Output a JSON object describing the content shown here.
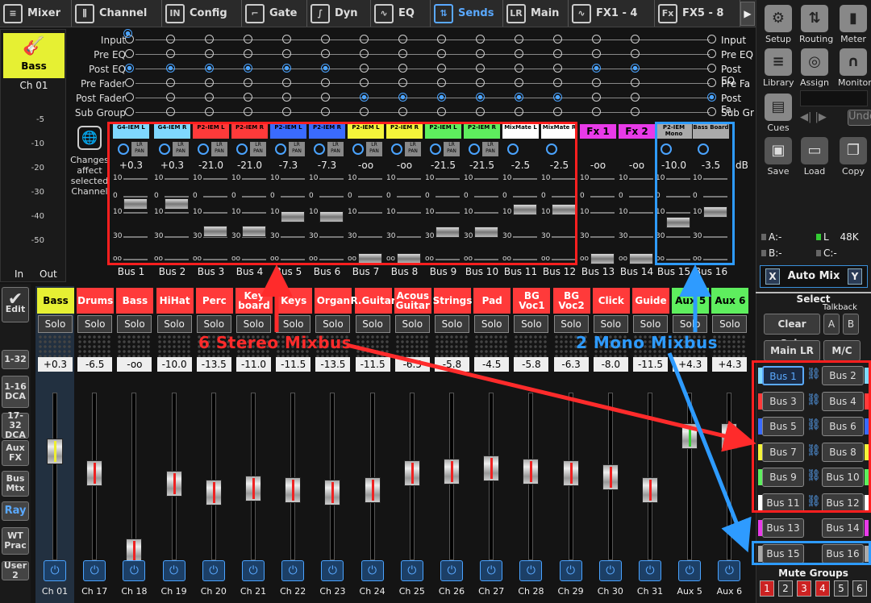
{
  "tabs": [
    {
      "label": "Mixer",
      "icon": "mixer-icon"
    },
    {
      "label": "Channel",
      "icon": "channel-icon"
    },
    {
      "label": "Config",
      "icon": "config-icon"
    },
    {
      "label": "Gate",
      "icon": "gate-icon"
    },
    {
      "label": "Dyn",
      "icon": "dynamics-icon"
    },
    {
      "label": "EQ",
      "icon": "eq-icon"
    },
    {
      "label": "Sends",
      "icon": "sends-icon",
      "active": true
    },
    {
      "label": "Main",
      "icon": "main-icon"
    },
    {
      "label": "FX1 - 4",
      "icon": "fx-wave-icon"
    },
    {
      "label": "FX5 - 8",
      "icon": "fx-icon"
    }
  ],
  "selected_channel": {
    "name": "Bass",
    "number": "Ch 01",
    "in_label": "In",
    "out_label": "Out",
    "scale": [
      "-5",
      "-10",
      "-20",
      "-30",
      "-40",
      "-50"
    ]
  },
  "tap_points": [
    "Input",
    "Pre EQ",
    "Post EQ",
    "Pre Fader",
    "Post Fader",
    "Sub Group"
  ],
  "tap_points_right": [
    "Input",
    "Pre EQ",
    "Post EQ",
    "Pre Fa",
    "Post Fa",
    "Sub Gr"
  ],
  "changes_note": [
    "Changes",
    "affect",
    "selected",
    "Channel"
  ],
  "sends": [
    {
      "label": "G4-IEM L",
      "value": "+0.3",
      "bus": "Bus 1",
      "color": "#7fd8ff",
      "lrpan": true,
      "level": 0.7
    },
    {
      "label": "G4-IEM R",
      "value": "+0.3",
      "bus": "Bus 2",
      "color": "#7fd8ff",
      "lrpan": true,
      "level": 0.7
    },
    {
      "label": "P2-IEM L",
      "value": "-21.0",
      "bus": "Bus 3",
      "color": "#ff3a3a",
      "lrpan": true,
      "level": 0.36
    },
    {
      "label": "P2-IEM R",
      "value": "-21.0",
      "bus": "Bus 4",
      "color": "#ff3a3a",
      "lrpan": true,
      "level": 0.36
    },
    {
      "label": "P2-IEM L",
      "value": "-7.3",
      "bus": "Bus 5",
      "color": "#3a6bff",
      "lrpan": true,
      "level": 0.54
    },
    {
      "label": "P2-IEM R",
      "value": "-7.3",
      "bus": "Bus 6",
      "color": "#3a6bff",
      "lrpan": true,
      "level": 0.54
    },
    {
      "label": "P2-IEM L",
      "value": "-oo",
      "bus": "Bus 7",
      "color": "#f4f43a",
      "lrpan": true,
      "level": 0.02
    },
    {
      "label": "P2-IEM R",
      "value": "-oo",
      "bus": "Bus 8",
      "color": "#f4f43a",
      "lrpan": true,
      "level": 0.02
    },
    {
      "label": "P2-IEM L",
      "value": "-21.5",
      "bus": "Bus 9",
      "color": "#5eee5e",
      "lrpan": true,
      "level": 0.35
    },
    {
      "label": "P2-IEM R",
      "value": "-21.5",
      "bus": "Bus 10",
      "color": "#5eee5e",
      "lrpan": true,
      "level": 0.35
    },
    {
      "label": "MixMate L",
      "value": "-2.5",
      "bus": "Bus 11",
      "color": "#ffffff",
      "lrpan": false,
      "level": 0.63
    },
    {
      "label": "MixMate R",
      "value": "-2.5",
      "bus": "Bus 12",
      "color": "#ffffff",
      "lrpan": false,
      "level": 0.63
    },
    {
      "label": "Fx 1",
      "value": "-oo",
      "bus": "Bus 13",
      "color": "#e83ae8",
      "lrpan": false,
      "level": 0.02
    },
    {
      "label": "Fx 2",
      "value": "-oo",
      "bus": "Bus 14",
      "color": "#e83ae8",
      "lrpan": false,
      "level": 0.02
    },
    {
      "label": "P2-IEM Mono",
      "value": "-10.0",
      "bus": "Bus 15",
      "color": "#aaaaaa",
      "lrpan": false,
      "level": 0.47
    },
    {
      "label": "Bass Board",
      "value": "-3.5",
      "bus": "Bus 16",
      "color": "#aaaaaa",
      "lrpan": false,
      "level": 0.6
    }
  ],
  "send_scale": [
    "10",
    "0",
    "10",
    "30",
    "oo"
  ],
  "db_unit": "dB",
  "right_panel": {
    "top_buttons": [
      {
        "label": "Setup",
        "icon": "gear-icon"
      },
      {
        "label": "Routing",
        "icon": "routing-icon"
      },
      {
        "label": "Meter",
        "icon": "meter-icon"
      },
      {
        "label": "Library",
        "icon": "library-icon"
      },
      {
        "label": "Assign",
        "icon": "assign-icon"
      },
      {
        "label": "Monitor",
        "icon": "headphones-icon"
      },
      {
        "label": "Cues",
        "icon": "cues-icon"
      },
      {
        "label": "Save",
        "icon": "save-icon"
      },
      {
        "label": "Load",
        "icon": "load-icon"
      },
      {
        "label": "Copy",
        "icon": "copy-icon"
      }
    ],
    "undo_label": "Undo",
    "status": {
      "a": "A:-",
      "l": "L",
      "rate": "48K",
      "b": "B:-",
      "c": "C:-"
    },
    "automix": {
      "label": "Auto Mix",
      "x": "X",
      "y": "Y"
    },
    "select_title": "Select",
    "talkback_label": "Talkback",
    "clear_solo": "Clear Solo",
    "talkback_a": "A",
    "talkback_b": "B",
    "main_lr": "Main LR",
    "mc": "M/C",
    "bus_buttons": [
      "Bus 1",
      "Bus 2",
      "Bus 3",
      "Bus 4",
      "Bus 5",
      "Bus 6",
      "Bus 7",
      "Bus 8",
      "Bus 9",
      "Bus 10",
      "Bus 11",
      "Bus 12",
      "Bus 13",
      "Bus 14",
      "Bus 15",
      "Bus 16"
    ],
    "bus_colors": [
      "#7fd8ff",
      "#ff3a3a",
      "#3a6bff",
      "#f4f43a",
      "#5eee5e",
      "#ffffff",
      "#e83ae8",
      "#aaaaaa"
    ],
    "mute_groups_title": "Mute Groups",
    "mute_groups": [
      "1",
      "2",
      "3",
      "4",
      "5",
      "6"
    ],
    "mute_on": [
      true,
      false,
      true,
      true,
      false,
      false
    ]
  },
  "left_nav": [
    {
      "label": "Edit",
      "icon": "checkmark-icon"
    },
    {
      "label": "1-32"
    },
    {
      "label": "1-16 DCA"
    },
    {
      "label": "17-32 DCA"
    },
    {
      "label": "Aux FX"
    },
    {
      "label": "Bus Mtx"
    },
    {
      "label": "Ray",
      "active": true
    },
    {
      "label": "WT Prac"
    },
    {
      "label": "User 2"
    }
  ],
  "strips": [
    {
      "name": "Bass",
      "color": "#e6f033",
      "value": "+0.3",
      "num": "Ch 01",
      "level": 0.7,
      "cap": "yel"
    },
    {
      "name": "Drums",
      "color": "#ff3a3a",
      "value": "-6.5",
      "num": "Ch 17",
      "level": 0.56
    },
    {
      "name": "Bass",
      "color": "#ff3a3a",
      "value": "-oo",
      "num": "Ch 18",
      "level": 0.05
    },
    {
      "name": "HiHat",
      "color": "#ff3a3a",
      "value": "-10.0",
      "num": "Ch 19",
      "level": 0.49
    },
    {
      "name": "Perc",
      "color": "#ff3a3a",
      "value": "-13.5",
      "num": "Ch 20",
      "level": 0.43
    },
    {
      "name": "Key board",
      "color": "#ff3a3a",
      "value": "-11.0",
      "num": "Ch 21",
      "level": 0.46
    },
    {
      "name": "Keys",
      "color": "#ff3a3a",
      "value": "-11.5",
      "num": "Ch 22",
      "level": 0.45
    },
    {
      "name": "Organ",
      "color": "#ff3a3a",
      "value": "-13.5",
      "num": "Ch 23",
      "level": 0.43
    },
    {
      "name": "R.Guitar",
      "color": "#ff3a3a",
      "value": "-11.5",
      "num": "Ch 24",
      "level": 0.45
    },
    {
      "name": "Acous Guitar",
      "color": "#ff3a3a",
      "value": "-6.5",
      "num": "Ch 25",
      "level": 0.56
    },
    {
      "name": "Strings",
      "color": "#ff3a3a",
      "value": "-5.8",
      "num": "Ch 26",
      "level": 0.57
    },
    {
      "name": "Pad",
      "color": "#ff3a3a",
      "value": "-4.5",
      "num": "Ch 27",
      "level": 0.59
    },
    {
      "name": "BG Voc1",
      "color": "#ff3a3a",
      "value": "-5.8",
      "num": "Ch 28",
      "level": 0.57
    },
    {
      "name": "BG Voc2",
      "color": "#ff3a3a",
      "value": "-6.3",
      "num": "Ch 29",
      "level": 0.56
    },
    {
      "name": "Click",
      "color": "#ff3a3a",
      "value": "-8.0",
      "num": "Ch 30",
      "level": 0.53
    },
    {
      "name": "Guide",
      "color": "#ff3a3a",
      "value": "-11.5",
      "num": "Ch 31",
      "level": 0.45
    },
    {
      "name": "Aux 5",
      "color": "#5eee5e",
      "value": "+4.3",
      "num": "Aux 5",
      "level": 0.8,
      "cap": "grn"
    },
    {
      "name": "Aux 6",
      "color": "#5eee5e",
      "value": "+4.3",
      "num": "Aux 6",
      "level": 0.8,
      "cap": "grn"
    }
  ],
  "solo_label": "Solo",
  "annotations": {
    "stereo": "6 Stereo Mixbus",
    "mono": "2 Mono Mixbus",
    "stereo_color": "#ff2b2b",
    "mono_color": "#2e9bff"
  }
}
